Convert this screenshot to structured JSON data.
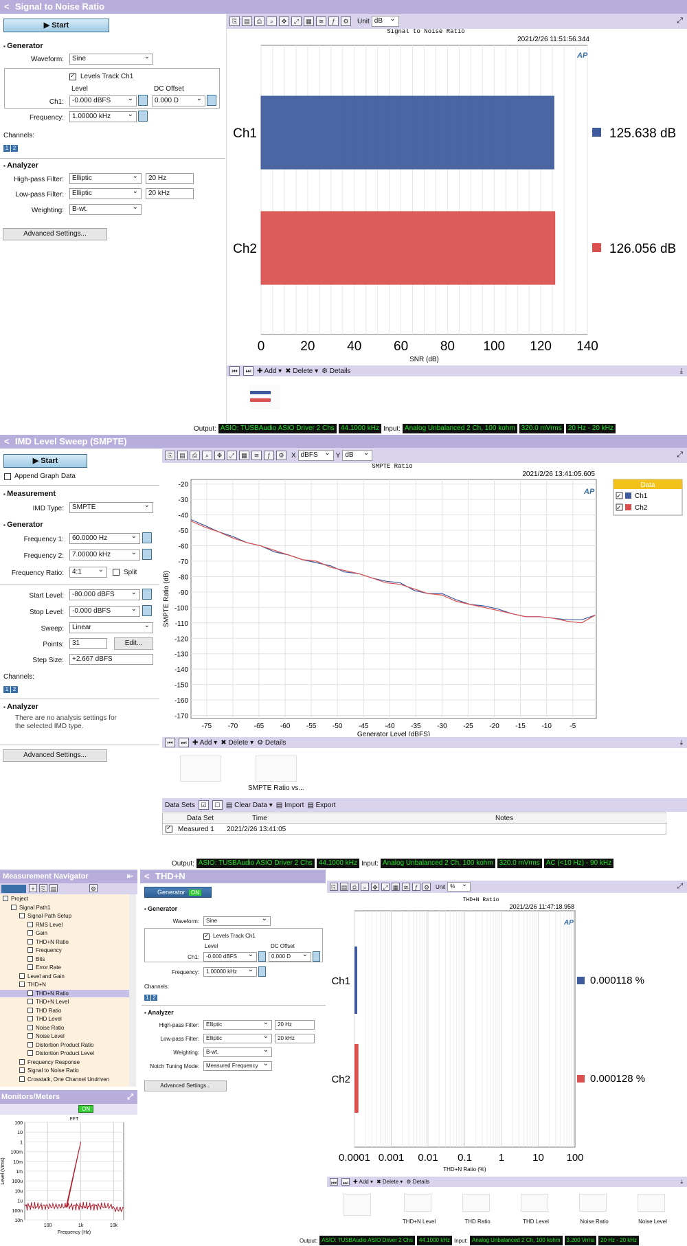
{
  "snr": {
    "title": "Signal to Noise Ratio",
    "start": "Start",
    "generator": "Generator",
    "waveform_label": "Waveform:",
    "waveform": "Sine",
    "levels_track": "Levels Track Ch1",
    "level_label": "Level",
    "dc_offset_label": "DC Offset",
    "ch1_label": "Ch1:",
    "ch1_level": "-0.000 dBFS",
    "dc_offset": "0.000 D",
    "frequency_label": "Frequency:",
    "frequency": "1.00000 kHz",
    "channels_label": "Channels:",
    "ch_btn1": "1",
    "ch_btn2": "2",
    "analyzer": "Analyzer",
    "hp_label": "High-pass Filter:",
    "hp": "Elliptic",
    "hp_val": "20 Hz",
    "lp_label": "Low-pass Filter:",
    "lp": "Elliptic",
    "lp_val": "20 kHz",
    "weighting_label": "Weighting:",
    "weighting": "B-wt.",
    "advanced": "Advanced Settings...",
    "unit_label": "Unit",
    "unit": "dB",
    "bottom": {
      "add": "Add",
      "delete": "Delete",
      "details": "Details"
    },
    "status": {
      "output_label": "Output:",
      "out1": "ASIO: TUSBAudio ASIO Driver 2 Chs",
      "out2": "44.1000 kHz",
      "input_label": "Input:",
      "in1": "Analog Unbalanced 2 Ch, 100 kohm",
      "in2": "320.0 mVrms",
      "in3": "20 Hz - 20 kHz"
    }
  },
  "imd": {
    "title": "IMD Level Sweep (SMPTE)",
    "start": "Start",
    "append": "Append Graph Data",
    "measurement": "Measurement",
    "imd_type_label": "IMD Type:",
    "imd_type": "SMPTE",
    "generator": "Generator",
    "f1_label": "Frequency 1:",
    "f1": "60.0000 Hz",
    "f2_label": "Frequency 2:",
    "f2": "7.00000 kHz",
    "ratio_label": "Frequency Ratio:",
    "ratio": "4:1",
    "split": "Split",
    "start_level_label": "Start Level:",
    "start_level": "-80.000 dBFS",
    "stop_level_label": "Stop Level:",
    "stop_level": "-0.000 dBFS",
    "sweep_label": "Sweep:",
    "sweep": "Linear",
    "points_label": "Points:",
    "points": "31",
    "edit": "Edit...",
    "step_label": "Step Size:",
    "step": "+2.667 dBFS",
    "channels_label": "Channels:",
    "ch_btn1": "1",
    "ch_btn2": "2",
    "analyzer": "Analyzer",
    "no_analysis": "There are no analysis settings for the selected IMD type.",
    "advanced": "Advanced Settings...",
    "x_label": "X",
    "x_unit": "dBFS",
    "y_label": "Y",
    "y_unit": "dB",
    "legend_title": "Data",
    "legend": [
      "Ch1",
      "Ch2"
    ],
    "bottom": {
      "add": "Add",
      "delete": "Delete",
      "details": "Details"
    },
    "thumb_label": "SMPTE Ratio vs...",
    "datasets": {
      "title": "Data Sets",
      "clear": "Clear Data",
      "import": "Import",
      "export": "Export",
      "headers": [
        "Data Set",
        "Time",
        "Notes"
      ],
      "row": {
        "name": "Measured 1",
        "time": "2021/2/26 13:41:05",
        "notes": ""
      }
    },
    "status": {
      "output_label": "Output:",
      "out1": "ASIO: TUSBAudio ASIO Driver 2 Chs",
      "out2": "44.1000 kHz",
      "input_label": "Input:",
      "in1": "Analog Unbalanced 2 Ch, 100 kohm",
      "in2": "320.0 mVrms",
      "in3": "AC (<10 Hz) - 90 kHz"
    }
  },
  "nav": {
    "title": "Measurement Navigator",
    "items": [
      {
        "label": "Project",
        "indent": 0,
        "sel": false
      },
      {
        "label": "Signal Path1",
        "indent": 1,
        "sel": false
      },
      {
        "label": "Signal Path Setup",
        "indent": 2,
        "sel": false
      },
      {
        "label": "RMS Level",
        "indent": 3,
        "sel": false
      },
      {
        "label": "Gain",
        "indent": 3,
        "sel": false
      },
      {
        "label": "THD+N Ratio",
        "indent": 3,
        "sel": false
      },
      {
        "label": "Frequency",
        "indent": 3,
        "sel": false
      },
      {
        "label": "Bits",
        "indent": 3,
        "sel": false
      },
      {
        "label": "Error Rate",
        "indent": 3,
        "sel": false
      },
      {
        "label": "Level and Gain",
        "indent": 2,
        "sel": false
      },
      {
        "label": "THD+N",
        "indent": 2,
        "sel": false
      },
      {
        "label": "THD+N Ratio",
        "indent": 3,
        "sel": true
      },
      {
        "label": "THD+N Level",
        "indent": 3,
        "sel": false
      },
      {
        "label": "THD Ratio",
        "indent": 3,
        "sel": false
      },
      {
        "label": "THD Level",
        "indent": 3,
        "sel": false
      },
      {
        "label": "Noise Ratio",
        "indent": 3,
        "sel": false
      },
      {
        "label": "Noise Level",
        "indent": 3,
        "sel": false
      },
      {
        "label": "Distortion Product Ratio",
        "indent": 3,
        "sel": false
      },
      {
        "label": "Distortion Product Level",
        "indent": 3,
        "sel": false
      },
      {
        "label": "Frequency Response",
        "indent": 2,
        "sel": false
      },
      {
        "label": "Signal to Noise Ratio",
        "indent": 2,
        "sel": false
      },
      {
        "label": "Crosstalk, One Channel Undriven",
        "indent": 2,
        "sel": false
      }
    ]
  },
  "monitors": {
    "title": "Monitors/Meters",
    "on": "ON"
  },
  "thdn": {
    "title": "THD+N",
    "generator_btn": "Generator",
    "on": "ON",
    "generator": "Generator",
    "waveform_label": "Waveform:",
    "waveform": "Sine",
    "levels_track": "Levels Track Ch1",
    "level_label": "Level",
    "dc_offset_label": "DC Offset",
    "ch1_label": "Ch1:",
    "ch1_level": "-0.000 dBFS",
    "dc_offset": "0.000 D",
    "frequency_label": "Frequency:",
    "frequency": "1.00000 kHz",
    "channels_label": "Channels:",
    "ch_btn1": "1",
    "ch_btn2": "2",
    "analyzer": "Analyzer",
    "hp_label": "High-pass Filter:",
    "hp": "Elliptic",
    "hp_val": "20 Hz",
    "lp_label": "Low-pass Filter:",
    "lp": "Elliptic",
    "lp_val": "20 kHz",
    "weighting_label": "Weighting:",
    "weighting": "B-wt.",
    "notch_label": "Notch Tuning Mode:",
    "notch": "Measured Frequency",
    "advanced": "Advanced Settings...",
    "unit_label": "Unit",
    "unit": "%",
    "bottom": {
      "add": "Add",
      "delete": "Delete",
      "details": "Details"
    },
    "thumbs": [
      "THD+N Level",
      "THD Ratio",
      "THD Level",
      "Noise Ratio",
      "Noise Level"
    ],
    "status": {
      "output_label": "Output:",
      "out1": "ASIO: TUSBAudio ASIO Driver 2 Chs",
      "out2": "44.1000 kHz",
      "input_label": "Input:",
      "in1": "Analog Unbalanced 2 Ch, 100 kohm",
      "in2": "3.200 Vrms",
      "in3": "20 Hz - 20 kHz"
    }
  },
  "chart_data": [
    {
      "type": "bar",
      "title": "Signal to Noise Ratio",
      "timestamp": "2021/2/26 11:51:56.344",
      "categories": [
        "Ch1",
        "Ch2"
      ],
      "values": [
        125.638,
        126.056
      ],
      "value_labels": [
        "125.638 dB",
        "126.056 dB"
      ],
      "colors": [
        "#3e5a9c",
        "#d9504f"
      ],
      "xlabel": "SNR (dB)",
      "xlim": [
        0,
        140
      ],
      "xticks": [
        "0",
        "20",
        "40",
        "60",
        "80",
        "100",
        "120",
        "140"
      ],
      "logo": "AP"
    },
    {
      "type": "line",
      "title": "SMPTE Ratio",
      "timestamp": "2021/2/26 13:41:05.605",
      "xlabel": "Generator Level (dBFS)",
      "ylabel": "SMPTE Ratio (dB)",
      "xlim": [
        -78,
        -0.5
      ],
      "ylim": [
        -172,
        -17
      ],
      "xticks": [
        "-75",
        "-70",
        "-65",
        "-60",
        "-55",
        "-50",
        "-45",
        "-40",
        "-35",
        "-30",
        "-25",
        "-20",
        "-15",
        "-10",
        "-5"
      ],
      "yticks": [
        "-20",
        "-30",
        "-40",
        "-50",
        "-60",
        "-70",
        "-80",
        "-90",
        "-100",
        "-110",
        "-120",
        "-130",
        "-140",
        "-150",
        "-160",
        "-170"
      ],
      "x": [
        -78,
        -75.3,
        -72.7,
        -70,
        -67.3,
        -64.7,
        -62,
        -59.3,
        -56.7,
        -54,
        -51.3,
        -48.7,
        -46,
        -43.3,
        -40.7,
        -38,
        -35.3,
        -32.7,
        -30,
        -27.3,
        -24.7,
        -22,
        -19.3,
        -16.7,
        -14,
        -11.3,
        -8.7,
        -6,
        -3.3,
        -0.7
      ],
      "series": [
        {
          "name": "Ch1",
          "color": "#3e5a9c",
          "values": [
            -43,
            -47,
            -51,
            -54,
            -58,
            -60,
            -64,
            -66,
            -69,
            -71,
            -73,
            -77,
            -78,
            -81,
            -83,
            -84,
            -89,
            -91,
            -91,
            -95,
            -98,
            -99,
            -101,
            -104,
            -106,
            -106,
            -107,
            -108,
            -108,
            -105
          ]
        },
        {
          "name": "Ch2",
          "color": "#d9504f",
          "values": [
            -44,
            -48,
            -51,
            -55,
            -58,
            -60,
            -63,
            -66,
            -69,
            -70,
            -74,
            -76,
            -78,
            -81,
            -84,
            -85,
            -88,
            -91,
            -92,
            -96,
            -98,
            -100,
            -102,
            -104,
            -106,
            -106,
            -107,
            -109,
            -110,
            -105
          ]
        }
      ],
      "legend": "top-right",
      "logo": "AP"
    },
    {
      "type": "bar",
      "title": "THD+N Ratio",
      "timestamp": "2021/2/26 11:47:18.958",
      "categories": [
        "Ch1",
        "Ch2"
      ],
      "values": [
        0.000118,
        0.000128
      ],
      "value_labels": [
        "0.000118 %",
        "0.000128 %"
      ],
      "colors": [
        "#3e5a9c",
        "#d9504f"
      ],
      "xlabel": "THD+N Ratio (%)",
      "xscale": "log",
      "xlim": [
        0.0001,
        100
      ],
      "xticks": [
        "0.0001",
        "0.001",
        "0.01",
        "0.1",
        "1",
        "10",
        "100"
      ],
      "logo": "AP"
    },
    {
      "type": "line",
      "title": "FFT",
      "xlabel": "Frequency (Hz)",
      "ylabel": "Level (Vrms)",
      "xscale": "log",
      "yscale": "log",
      "xticks": [
        "100",
        "1k",
        "10k"
      ],
      "yticks": [
        "100",
        "10",
        "1",
        "100m",
        "10m",
        "1m",
        "100u",
        "10u",
        "1u",
        "100n",
        "10n"
      ],
      "peak_frequency_hz": 1000,
      "peak_level": "1"
    }
  ]
}
